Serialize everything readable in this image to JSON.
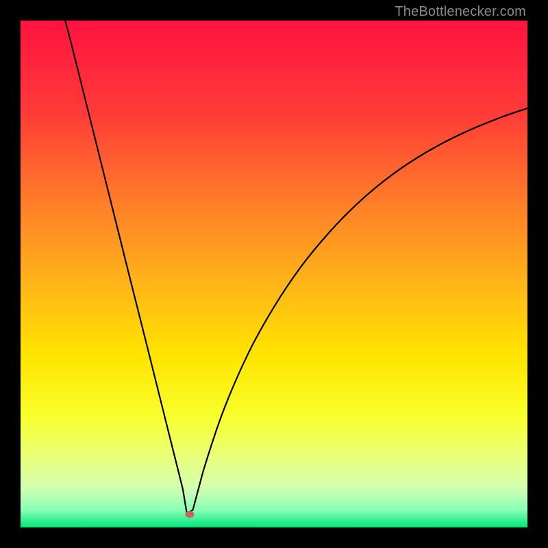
{
  "watermark": {
    "text": "TheBottlenecker.com"
  },
  "chart_data": {
    "type": "line",
    "title": "",
    "xlabel": "",
    "ylabel": "",
    "xlim": [
      0,
      100
    ],
    "ylim": [
      0,
      100
    ],
    "x": [
      8.8,
      10,
      12,
      14,
      16,
      18,
      20,
      22,
      24,
      26,
      28,
      30,
      32,
      32.8,
      34,
      36,
      40,
      45,
      50,
      55,
      60,
      65,
      70,
      75,
      80,
      85,
      90,
      95,
      100
    ],
    "y": [
      100,
      95.5,
      87.5,
      79.5,
      71.5,
      63.5,
      55.5,
      47.5,
      39.6,
      31.6,
      23.6,
      15.6,
      7.6,
      2.9,
      3.5,
      11,
      23,
      34.5,
      43.5,
      51,
      57.2,
      62.5,
      67,
      70.8,
      74,
      76.7,
      79,
      81,
      82.7
    ],
    "min_marker": {
      "x": 33.4,
      "y": 2.6
    },
    "gradient_stops": [
      {
        "offset": 0.0,
        "color": "#ff1240"
      },
      {
        "offset": 0.18,
        "color": "#ff3a38"
      },
      {
        "offset": 0.35,
        "color": "#ff7a2a"
      },
      {
        "offset": 0.52,
        "color": "#ffb518"
      },
      {
        "offset": 0.66,
        "color": "#ffe400"
      },
      {
        "offset": 0.78,
        "color": "#f8ff2b"
      },
      {
        "offset": 0.86,
        "color": "#eaff7a"
      },
      {
        "offset": 0.92,
        "color": "#d4ffb0"
      },
      {
        "offset": 0.965,
        "color": "#8cffb8"
      },
      {
        "offset": 1.0,
        "color": "#00e57a"
      }
    ]
  }
}
